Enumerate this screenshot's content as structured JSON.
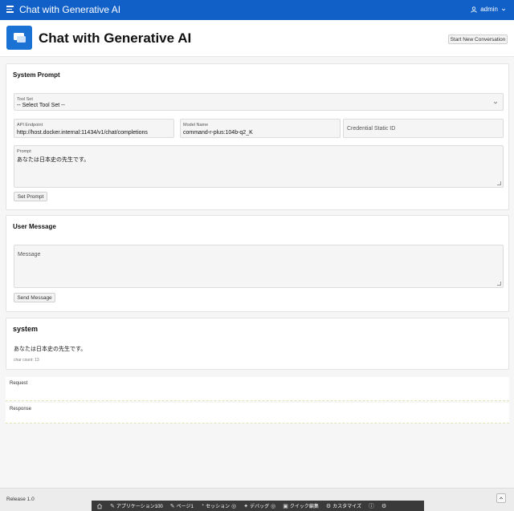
{
  "topbar": {
    "app_title": "Chat with Generative AI",
    "user": "admin"
  },
  "page_header": {
    "title": "Chat with Generative AI",
    "start_new_label": "Start New Conversation"
  },
  "system_prompt": {
    "title": "System Prompt",
    "tool_set": {
      "label": "Tool Set",
      "value": "-- Select Tool Set --"
    },
    "api_endpoint": {
      "label": "API Endpoint",
      "value": "http://host.docker.internal:11434/v1/chat/completions"
    },
    "model_name": {
      "label": "Model Name",
      "value": "command-r-plus:104b-q2_K"
    },
    "credential": {
      "placeholder": "Credential Static ID"
    },
    "prompt": {
      "label": "Prompt",
      "value": "あなたは日本史の先生です。"
    },
    "set_prompt_label": "Set Prompt"
  },
  "user_message": {
    "title": "User Message",
    "message_placeholder": "Message",
    "send_label": "Send Message"
  },
  "system_output": {
    "title": "system",
    "text": "あなたは日本史の先生です。",
    "char_count": "char count: 13"
  },
  "request_label": "Request",
  "response_label": "Response",
  "footer": {
    "release": "Release 1.0"
  },
  "devbar": {
    "app": "アプリケーション100",
    "page": "ページ1",
    "session": "セッション",
    "debug": "デバッグ",
    "quick_edit": "クイック編集",
    "customize": "カスタマイズ"
  }
}
